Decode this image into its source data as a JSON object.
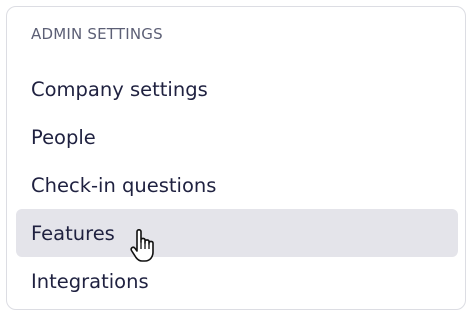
{
  "section": {
    "title": "ADMIN SETTINGS"
  },
  "menu": {
    "items": [
      {
        "label": "Company settings",
        "active": false
      },
      {
        "label": "People",
        "active": false
      },
      {
        "label": "Check-in questions",
        "active": false
      },
      {
        "label": "Features",
        "active": true
      },
      {
        "label": "Integrations",
        "active": false
      }
    ]
  },
  "colors": {
    "text": "#1f2140",
    "heading": "#5c5f75",
    "active_bg": "#e4e4ea",
    "border": "#dcdde3"
  },
  "cursor": {
    "icon": "hand-pointer-icon"
  }
}
